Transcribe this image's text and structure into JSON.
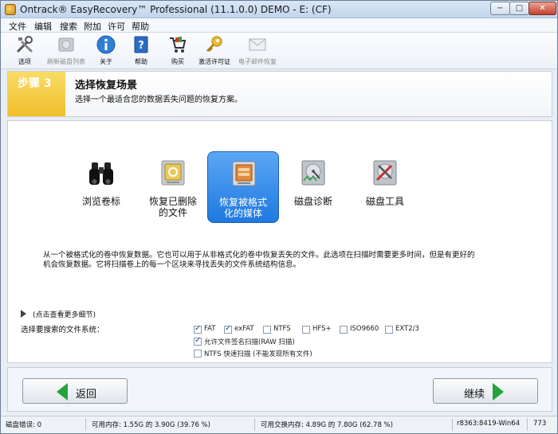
{
  "window": {
    "title": "Ontrack® EasyRecovery™ Professional (11.1.0.0) DEMO - E: (CF)",
    "min_glyph": "−",
    "max_glyph": "□",
    "close_glyph": "✕"
  },
  "menu": [
    "文件",
    "编辑",
    "搜索",
    "附加",
    "许可",
    "帮助"
  ],
  "toolbar": [
    {
      "label": "选项",
      "icon": "tools-icon",
      "enabled": true
    },
    {
      "label": "刷新磁盘列表",
      "icon": "disk-refresh-icon",
      "enabled": false
    },
    {
      "label": "关于",
      "icon": "info-icon",
      "enabled": true
    },
    {
      "label": "帮助",
      "icon": "help-book-icon",
      "enabled": true
    },
    {
      "label": "购买",
      "icon": "cart-icon",
      "enabled": true
    },
    {
      "label": "激活许可证",
      "icon": "key-icon",
      "enabled": true
    },
    {
      "label": "电子邮件恢复",
      "icon": "email-icon",
      "enabled": false
    }
  ],
  "step": {
    "number": "步骤 3",
    "title": "选择恢复场景",
    "subtitle": "选择一个最适合您的数据丢失问题的恢复方案。"
  },
  "scenarios": [
    {
      "line1": "浏览卷标",
      "line2": "",
      "icon": "binoculars-icon",
      "selected": false
    },
    {
      "line1": "恢复已删除",
      "line2": "的文件",
      "icon": "recycle-disk-icon",
      "selected": false
    },
    {
      "line1": "恢复被格式",
      "line2": "化的媒体",
      "icon": "formatted-media-icon",
      "selected": true
    },
    {
      "line1": "磁盘诊断",
      "line2": "",
      "icon": "disk-diagnostic-icon",
      "selected": false
    },
    {
      "line1": "磁盘工具",
      "line2": "",
      "icon": "disk-tools-icon",
      "selected": false
    }
  ],
  "description": {
    "line1": "从一个被格式化的卷中恢复数据。它也可以用于从非格式化的卷中恢复丢失的文件。此选项在扫描时需要更多时间，但是有更好的",
    "line2": "机会恢复数据。它将扫描卷上的每一个区块来寻找丢失的文件系统结构信息。"
  },
  "more_details": "(点击查看更多细节)",
  "fs_label": "选择要搜索的文件系统：",
  "filesystems": [
    {
      "label": "FAT",
      "checked": true
    },
    {
      "label": "exFAT",
      "checked": true
    },
    {
      "label": "NTFS",
      "checked": false
    },
    {
      "label": "HFS+",
      "checked": false
    },
    {
      "label": "ISO9660",
      "checked": false
    },
    {
      "label": "EXT2/3",
      "checked": false
    }
  ],
  "options": [
    {
      "label": "允许文件签名扫描(RAW 扫描)",
      "checked": true
    },
    {
      "label": "NTFS 快速扫描 (不能发现所有文件)",
      "checked": false
    }
  ],
  "nav": {
    "back": "返回",
    "next": "继续"
  },
  "status": {
    "disk_errors": "磁盘错误: 0",
    "mem": "可用内存: 1.55G 的 3.90G (39.76 %)",
    "swap": "可用交换内存: 4.89G 的 7.80G (62.78 %)",
    "build": "r8363:8419-Win64",
    "code": "773"
  },
  "colors": {
    "selected": "#2f8ae9",
    "step_accent": "#f2c230",
    "arrow": "#22a43a"
  }
}
